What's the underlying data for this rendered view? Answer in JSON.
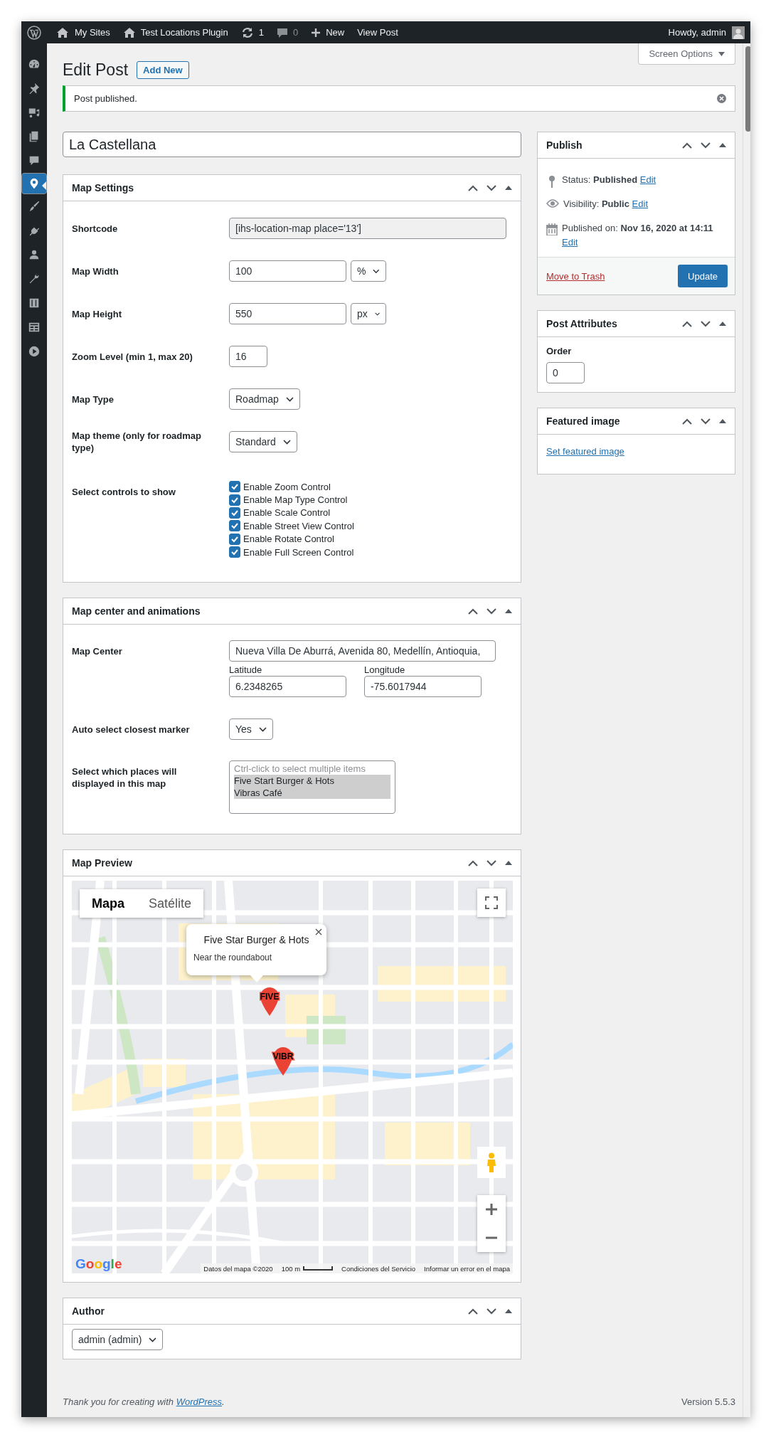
{
  "admin_bar": {
    "items": [
      {
        "kind": "wordpress"
      },
      {
        "kind": "sites",
        "label": "My Sites"
      },
      {
        "kind": "home",
        "label": "Test Locations Plugin"
      },
      {
        "kind": "updates",
        "label": "1"
      },
      {
        "kind": "comments",
        "label": "0"
      },
      {
        "kind": "new",
        "label": "New"
      },
      {
        "kind": "link",
        "label": "View Post"
      }
    ],
    "account": "Howdy, admin"
  },
  "sidebar": {
    "items": [
      {
        "selected": false
      },
      {
        "selected": false
      },
      {
        "selected": false
      },
      {
        "selected": false
      },
      {
        "selected": false
      },
      {
        "selected": true
      },
      {
        "selected": false
      },
      {
        "selected": false
      },
      {
        "selected": false
      },
      {
        "selected": false
      },
      {
        "selected": false
      },
      {
        "selected": false
      },
      {
        "selected": false
      }
    ]
  },
  "header": {
    "title": "Edit Post",
    "add_new": "Add New",
    "screen_options": "Screen Options"
  },
  "notice": "Post published.",
  "post_title": "La Castellana",
  "map_settings": {
    "title": "Map Settings",
    "rows": [
      {
        "kind": "readonly",
        "label": "Shortcode",
        "value": "[ihs-location-map place='13']"
      },
      {
        "kind": "number_unit",
        "label": "Map Width",
        "value": "100",
        "unit": "%"
      },
      {
        "kind": "number_unit",
        "label": "Map Height",
        "value": "550",
        "unit": "px"
      },
      {
        "kind": "number",
        "label": "Zoom Level (min 1, max 20)",
        "value": "16"
      },
      {
        "kind": "select",
        "label": "Map Type",
        "value": "Roadmap"
      },
      {
        "kind": "select",
        "label": "Map theme (only for roadmap type)",
        "value": "Standard"
      },
      {
        "kind": "checkboxes",
        "label": "Select controls to show",
        "options": [
          {
            "label": "Enable Zoom Control",
            "checked": true
          },
          {
            "label": "Enable Map Type Control",
            "checked": true
          },
          {
            "label": "Enable Scale Control",
            "checked": true
          },
          {
            "label": "Enable Street View Control",
            "checked": true
          },
          {
            "label": "Enable Rotate Control",
            "checked": true
          },
          {
            "label": "Enable Full Screen Control",
            "checked": true
          }
        ]
      }
    ]
  },
  "map_center": {
    "title": "Map center and animations",
    "center_label": "Map Center",
    "center": "Nueva Villa De Aburrá, Avenida 80, Medellín, Antioquia,",
    "latitude_label": "Latitude",
    "latitude": "6.2348265",
    "longitude_label": "Longitude",
    "longitude": "-75.6017944",
    "auto_select_label": "Auto select closest marker",
    "auto_select": "Yes",
    "places_label": "Select which places will displayed in this map",
    "places_hint": "Ctrl-click to select multiple items",
    "places": [
      {
        "label": "Five Start Burger & Hots",
        "selected": true
      },
      {
        "label": "Vibras Café",
        "selected": true
      }
    ]
  },
  "map_preview": {
    "title": "Map Preview",
    "map_types": [
      {
        "label": "Mapa",
        "selected": true
      },
      {
        "label": "Satélite",
        "selected": false
      }
    ],
    "info_window": {
      "title": "Five Star Burger & Hots",
      "text": "Near the roundabout"
    },
    "markers": [
      {
        "label": "FIVE"
      },
      {
        "label": "VIBR"
      }
    ],
    "logo": "Google",
    "attribution": "Datos del mapa ©2020",
    "scale": "100 m",
    "terms": "Condiciones del Servicio",
    "report": "Informar un error en el mapa"
  },
  "author": {
    "title": "Author",
    "value": "admin (admin)"
  },
  "publish": {
    "title": "Publish",
    "rows": [
      {
        "kind": "status",
        "text": "Status: **Published**",
        "link": "Edit"
      },
      {
        "kind": "visibility",
        "text": "Visibility: **Public**",
        "link": "Edit"
      },
      {
        "kind": "date",
        "text": "Published on: **Nov 16, 2020 at 14:11**",
        "link": "Edit"
      }
    ],
    "trash": "Move to Trash",
    "update": "Update"
  },
  "post_attributes": {
    "title": "Post Attributes",
    "order_label": "Order",
    "order": "0"
  },
  "featured_image": {
    "title": "Featured image",
    "link": "Set featured image"
  },
  "footer": {
    "thanks": "Thank you for creating with",
    "link": "WordPress",
    "end": ".",
    "version": "Version 5.5.3"
  }
}
